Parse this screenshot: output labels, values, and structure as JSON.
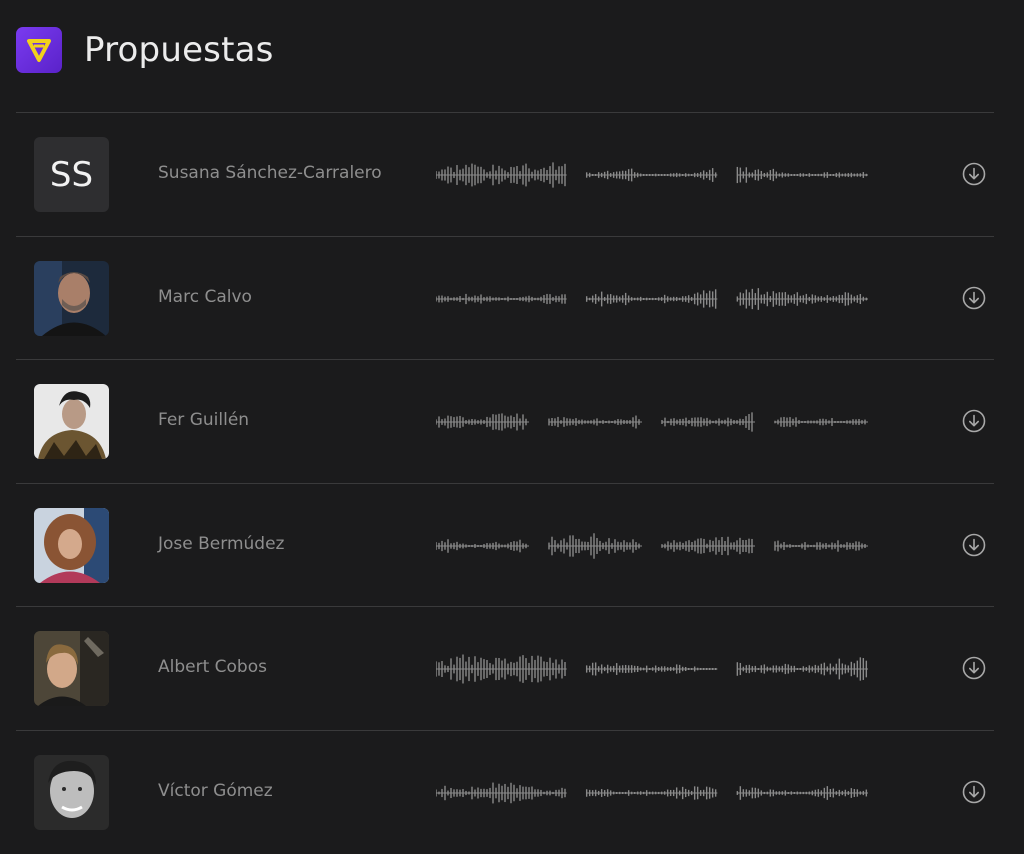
{
  "header": {
    "title": "Propuestas",
    "logo_icon": "triangle-v-logo",
    "logo_color": "#6b2fe0",
    "logo_accent": "#f2d21b"
  },
  "proposals": [
    {
      "name": "Susana Sánchez-Carralero",
      "initials": "SS",
      "avatar": "initials",
      "action_icon": "download-icon"
    },
    {
      "name": "Marc Calvo",
      "avatar": "photo",
      "action_icon": "download-icon"
    },
    {
      "name": "Fer Guillén",
      "avatar": "photo",
      "action_icon": "download-icon"
    },
    {
      "name": "Jose Bermúdez",
      "avatar": "photo",
      "action_icon": "download-icon"
    },
    {
      "name": "Albert Cobos",
      "avatar": "photo",
      "action_icon": "download-icon"
    },
    {
      "name": "Víctor Gómez",
      "avatar": "photo",
      "action_icon": "download-icon"
    }
  ],
  "colors": {
    "background": "#1b1b1c",
    "divider": "#3a3a3b",
    "waveform": "#8a8a8a",
    "text_muted": "#8e8e8e"
  }
}
